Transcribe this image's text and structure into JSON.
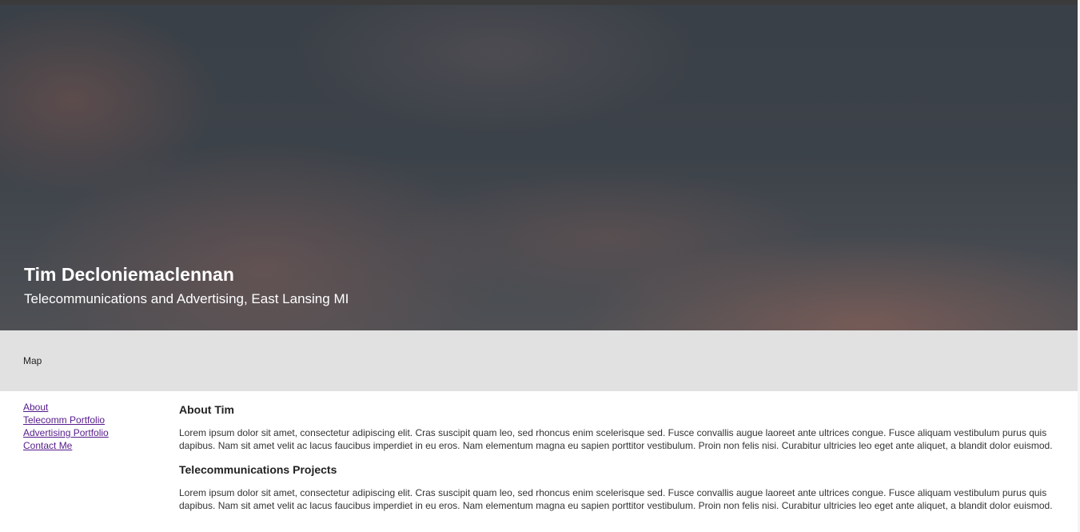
{
  "header": {
    "title": "Tim Decloniemaclennan",
    "subtitle": "Telecommunications and Advertising, East Lansing MI"
  },
  "map_bar": {
    "label": "Map"
  },
  "sidebar": {
    "links": [
      {
        "label": "About"
      },
      {
        "label": "Telecomm Portfolio"
      },
      {
        "label": "Advertising Portfolio"
      },
      {
        "label": "Contact Me"
      }
    ]
  },
  "main": {
    "sections": [
      {
        "heading": "About Tim",
        "body": "Lorem ipsum dolor sit amet, consectetur adipiscing elit. Cras suscipit quam leo, sed rhoncus enim scelerisque sed. Fusce convallis augue laoreet ante ultrices congue. Fusce aliquam vestibulum purus quis dapibus. Nam sit amet velit ac lacus faucibus imperdiet in eu eros. Nam elementum magna eu sapien porttitor vestibulum. Proin non felis nisi. Curabitur ultricies leo eget ante aliquet, a blandit dolor euismod."
      },
      {
        "heading": "Telecommunications Projects",
        "body": "Lorem ipsum dolor sit amet, consectetur adipiscing elit. Cras suscipit quam leo, sed rhoncus enim scelerisque sed. Fusce convallis augue laoreet ante ultrices congue. Fusce aliquam vestibulum purus quis dapibus. Nam sit amet velit ac lacus faucibus imperdiet in eu eros. Nam elementum magna eu sapien porttitor vestibulum. Proin non felis nisi. Curabitur ultricies leo eget ante aliquet, a blandit dolor euismod."
      }
    ]
  },
  "colors": {
    "top_strip": "#3b3b3b",
    "map_bar_background": "#e1e1e1",
    "visited_link": "#551a8b",
    "heading_text": "#222222",
    "body_text": "#333333",
    "hero_text": "#ffffff"
  }
}
